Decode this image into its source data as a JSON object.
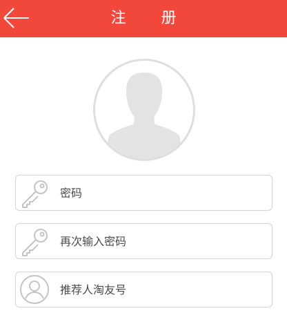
{
  "header": {
    "title": "注 册",
    "back_icon": "arrow-left-icon",
    "background": "#f2483c"
  },
  "avatar": {
    "icon": "user-silhouette-icon"
  },
  "form": {
    "password": {
      "placeholder": "密码",
      "value": "",
      "icon": "key-icon"
    },
    "confirm_password": {
      "placeholder": "再次输入密码",
      "value": "",
      "icon": "key-icon"
    },
    "referrer": {
      "placeholder": "推荐人淘友号",
      "value": "",
      "icon": "person-icon"
    }
  }
}
